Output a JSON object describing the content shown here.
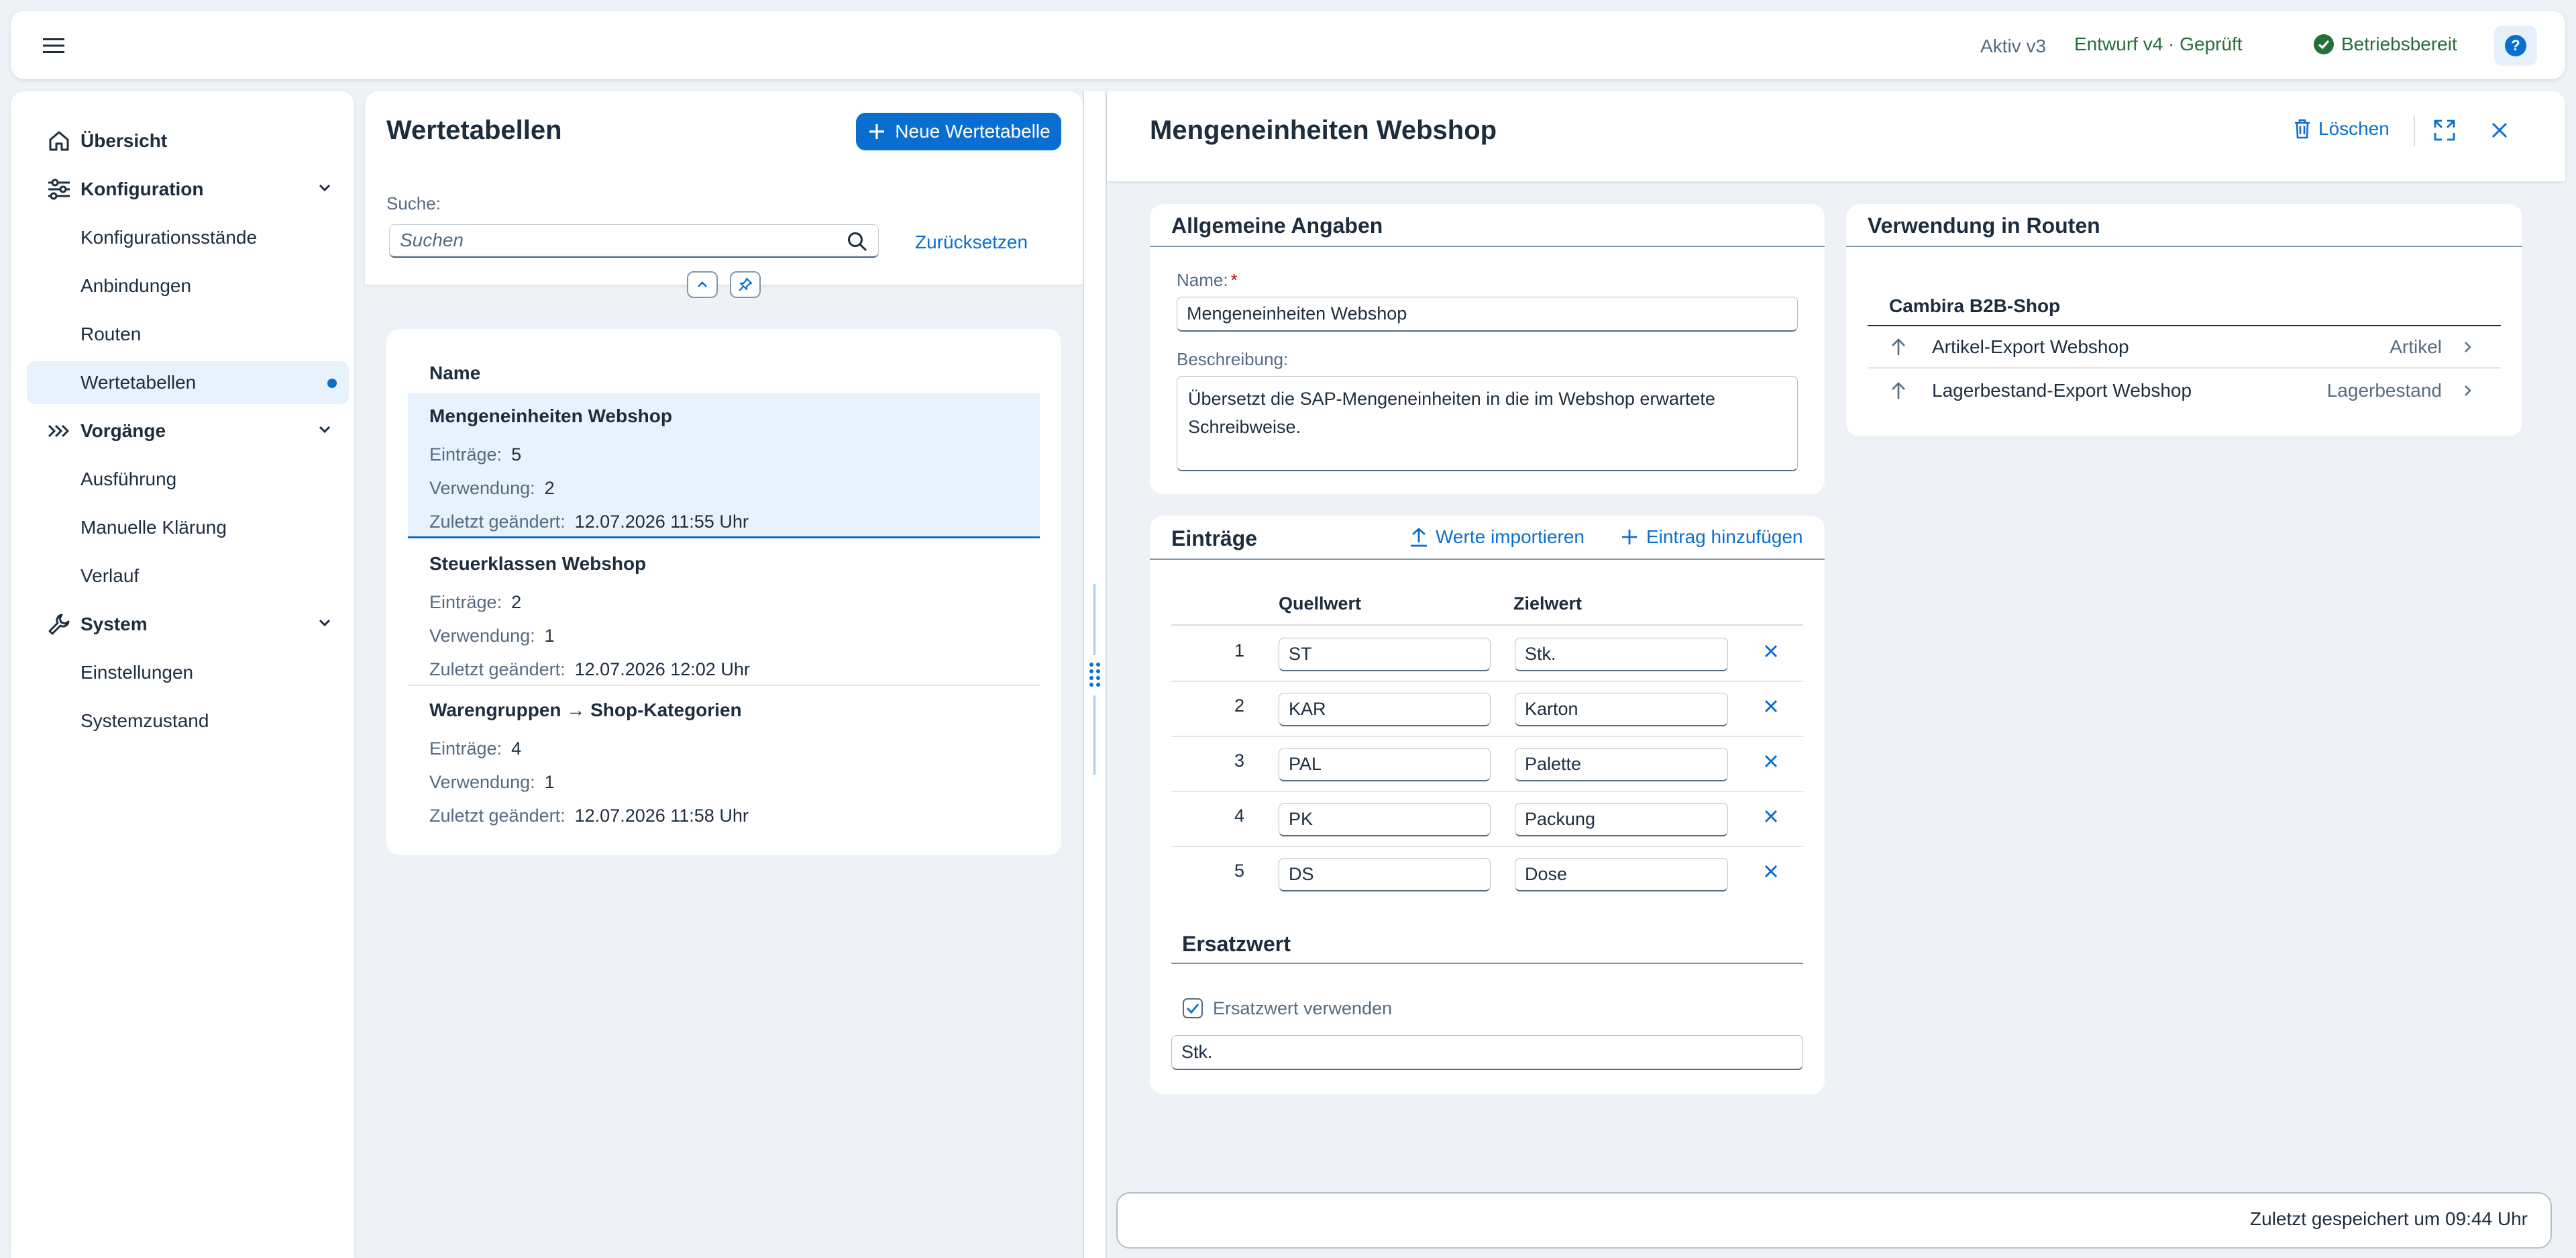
{
  "shell": {
    "status_active": "Aktiv v3",
    "status_draft": "Entwurf v4 · Geprüft",
    "status_ready": "Betriebsbereit",
    "help_icon": "help-icon",
    "colors": {
      "accent": "#0a6ed1",
      "success": "#256f3a"
    }
  },
  "nav": {
    "overview": "Übersicht",
    "config": "Konfiguration",
    "config_items": [
      "Konfigurationsstände",
      "Anbindungen",
      "Routen",
      "Wertetabellen"
    ],
    "processes": "Vorgänge",
    "process_items": [
      "Ausführung",
      "Manuelle Klärung",
      "Verlauf"
    ],
    "system": "System",
    "system_items": [
      "Einstellungen",
      "Systemzustand"
    ],
    "selected": "Wertetabellen"
  },
  "list": {
    "title": "Wertetabellen",
    "new_button": "Neue Wertetabelle",
    "search_label": "Suche:",
    "search_placeholder": "Suchen",
    "reset_label": "Zurücksetzen",
    "column_name": "Name",
    "labels": {
      "entries": "Einträge:",
      "usage": "Verwendung:",
      "changed": "Zuletzt geändert:"
    },
    "rows": [
      {
        "title": "Mengeneinheiten Webshop",
        "entries": "5",
        "usage": "2",
        "changed": "12.07.2026 11:55 Uhr"
      },
      {
        "title": "Steuerklassen Webshop",
        "entries": "2",
        "usage": "1",
        "changed": "12.07.2026 12:02 Uhr"
      },
      {
        "title": "Warengruppen → Shop-Kategorien",
        "entries": "4",
        "usage": "1",
        "changed": "12.07.2026 11:58 Uhr"
      }
    ]
  },
  "detail": {
    "title": "Mengeneinheiten Webshop",
    "delete_label": "Löschen",
    "general": {
      "title": "Allgemeine Angaben",
      "name_label": "Name:",
      "name_required": "*",
      "name_value": "Mengeneinheiten Webshop",
      "desc_label": "Beschreibung:",
      "desc_value": "Übersetzt die SAP-Mengeneinheiten in die im Webshop erwartete Schreibweise."
    },
    "usage": {
      "title": "Verwendung in Routen",
      "group": "Cambira B2B-Shop",
      "rows": [
        {
          "name": "Artikel-Export Webshop",
          "category": "Artikel"
        },
        {
          "name": "Lagerbestand-Export Webshop",
          "category": "Lagerbestand"
        }
      ]
    },
    "entries": {
      "title": "Einträge",
      "import_label": "Werte importieren",
      "add_label": "Eintrag hinzufügen",
      "col_source": "Quellwert",
      "col_target": "Zielwert",
      "rows": [
        {
          "no": "1",
          "source": "ST",
          "target": "Stk."
        },
        {
          "no": "2",
          "source": "KAR",
          "target": "Karton"
        },
        {
          "no": "3",
          "source": "PAL",
          "target": "Palette"
        },
        {
          "no": "4",
          "source": "PK",
          "target": "Packung"
        },
        {
          "no": "5",
          "source": "DS",
          "target": "Dose"
        }
      ],
      "fallback_title": "Ersatzwert",
      "fallback_checkbox": "Ersatzwert verwenden",
      "fallback_checked": true,
      "fallback_value": "Stk."
    }
  },
  "footer": {
    "saved_text": "Zuletzt gespeichert um 09:44 Uhr"
  }
}
